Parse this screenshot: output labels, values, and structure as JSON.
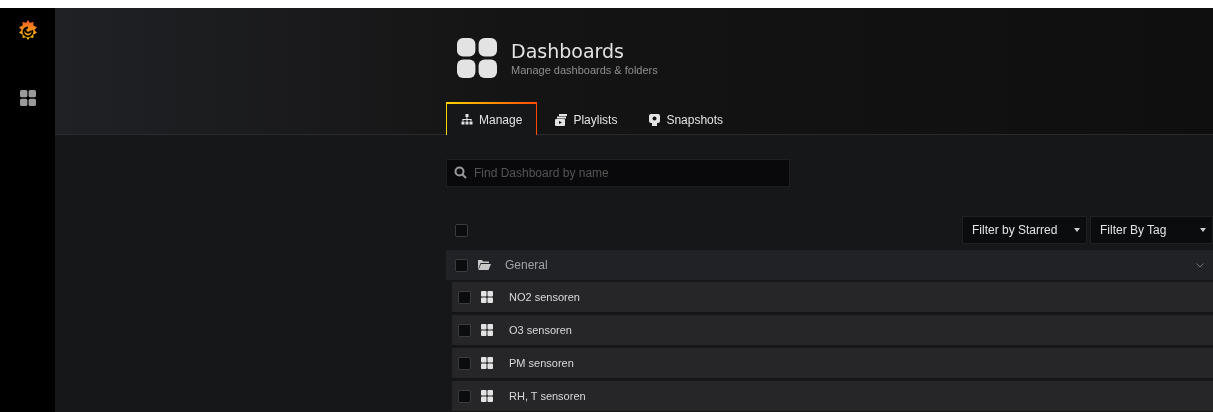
{
  "header": {
    "title": "Dashboards",
    "subtitle": "Manage dashboards & folders"
  },
  "tabs": [
    {
      "label": "Manage",
      "selected": true,
      "kind": "manage"
    },
    {
      "label": "Playlists",
      "selected": false,
      "kind": "playlists"
    },
    {
      "label": "Snapshots",
      "selected": false,
      "kind": "snapshots"
    }
  ],
  "search": {
    "placeholder": "Find Dashboard by name"
  },
  "select_all": {
    "checked": false
  },
  "filters": [
    "Filter by Starred",
    "Filter By Tag"
  ],
  "folder": {
    "name": "General",
    "checked": false,
    "expanded": true,
    "dashboards": [
      {
        "name": "NO2 sensoren",
        "checked": false
      },
      {
        "name": "O3 sensoren",
        "checked": false
      },
      {
        "name": "PM sensoren",
        "checked": false
      },
      {
        "name": "RH, T sensoren",
        "checked": false
      }
    ]
  }
}
